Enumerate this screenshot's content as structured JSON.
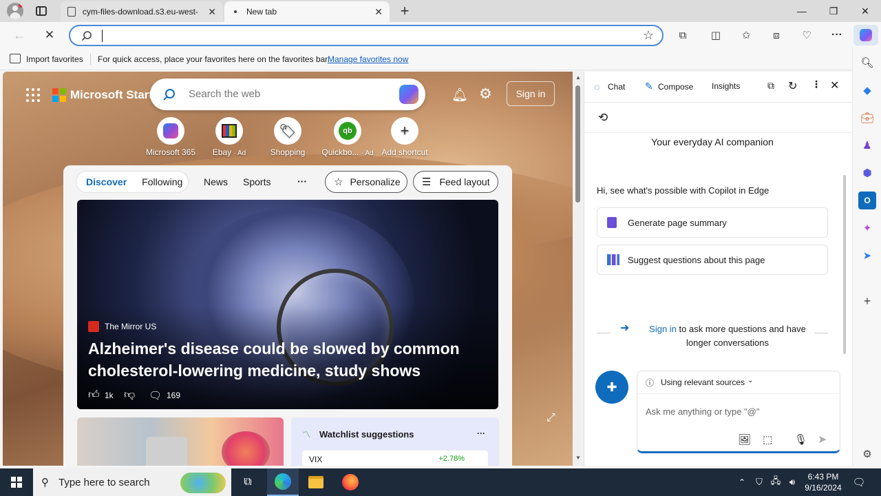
{
  "tabs": [
    {
      "title": "cym-files-download.s3.eu-west-",
      "close": "✕"
    },
    {
      "title": "New tab",
      "close": "✕"
    }
  ],
  "new_tab": "+",
  "window": {
    "minimize": "—",
    "maximize": "❐",
    "close": "✕"
  },
  "address": {
    "value": "",
    "placeholder": ""
  },
  "favbar": {
    "import_label": "Import favorites",
    "message": "For quick access, place your favorites here on the favorites bar.",
    "manage_link": "Manage favorites now"
  },
  "start": {
    "brand": "Microsoft Start",
    "search_placeholder": "Search the web",
    "signin": "Sign in",
    "shortcuts": [
      {
        "label": "Microsoft 365",
        "ad": ""
      },
      {
        "label": "Ebay",
        "ad": "· Ad"
      },
      {
        "label": "Shopping",
        "ad": ""
      },
      {
        "label": "Quickbo...",
        "ad": "· Ad"
      },
      {
        "label": "Add shortcut",
        "ad": ""
      }
    ],
    "feed_tabs": [
      "Discover",
      "Following",
      "News",
      "Sports"
    ],
    "more": "···",
    "personalize": "Personalize",
    "feed_layout": "Feed layout",
    "hero": {
      "source": "The Mirror US",
      "headline": "Alzheimer's disease could be slowed by common cholesterol-lowering medicine, study shows",
      "likes": "1k",
      "comments": "169"
    },
    "watchlist": {
      "title": "Watchlist suggestions",
      "more": "···",
      "symbol": "VIX",
      "change": "+2.78%"
    }
  },
  "copilot": {
    "tabs": [
      "Chat",
      "Compose",
      "Insights"
    ],
    "tagline": "Your everyday AI companion",
    "intro": "Hi, see what's possible with Copilot in Edge",
    "buttons": [
      "Generate page summary",
      "Suggest questions about this page"
    ],
    "signin_link": "Sign in",
    "signin_rest": "to ask more questions and have longer conversations",
    "sources": "Using relevant sources",
    "input_placeholder": "Ask me anything or type \"@\""
  },
  "taskbar": {
    "search_placeholder": "Type here to search",
    "time": "6:43 PM",
    "date": "9/16/2024"
  },
  "colors": {
    "accent": "#0f6cbd",
    "taskbar": "#1c2a3a",
    "link": "#0f5cbf"
  }
}
